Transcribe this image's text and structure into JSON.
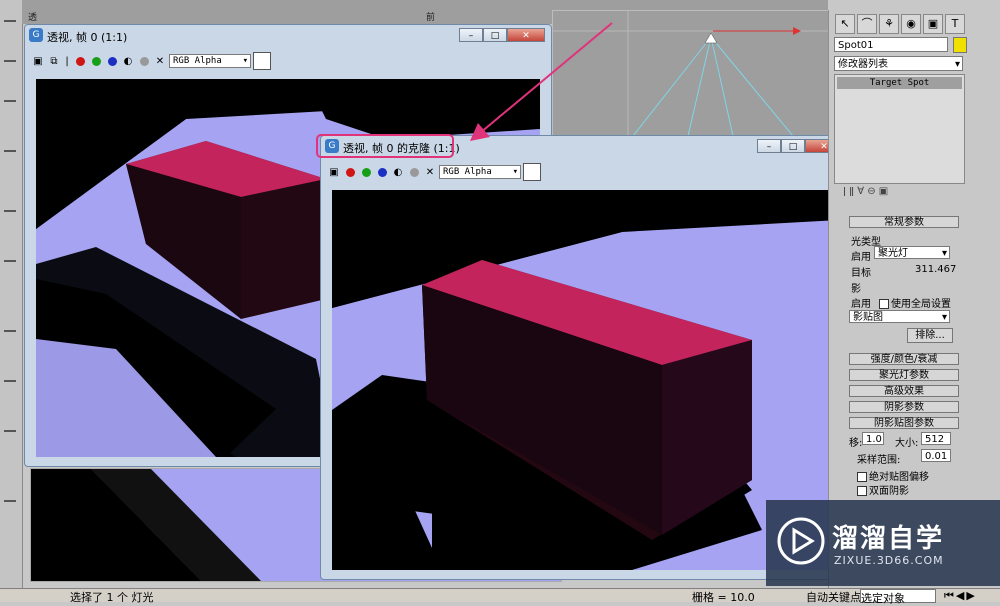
{
  "window_main": {
    "title": "透视, 帧 0 (1:1)",
    "channel": "RGB Alpha"
  },
  "window_clone": {
    "title": "透视, 帧 0 的克隆 (1:1)",
    "channel": "RGB Alpha"
  },
  "colors": {
    "accent_highlight": "#e0337a",
    "object_top": "#c3245c",
    "ground": "#a6a4f2",
    "red_channel": "#d01515",
    "green_channel": "#17a017",
    "blue_channel": "#1b2fc2"
  },
  "command_panel": {
    "object_name": "Spot01",
    "modifier_list": "修改器列表",
    "stack_item": "Target Spot",
    "rollout_general": "常规参数",
    "light_type_label": "光类型",
    "enable_label": "启用",
    "light_type_value": "聚光灯",
    "target_label": "目标",
    "target_value": "311.467",
    "shadow_label": "影",
    "shadow_enable": "启用",
    "use_global": "使用全局设置",
    "shadow_type": "影贴图",
    "exclude_button": "排除...",
    "rollout_intensity": "强度/颜色/衰减",
    "rollout_spot": "聚光灯参数",
    "rollout_advanced": "高级效果",
    "rollout_shadow": "阴影参数",
    "rollout_shadowmap": "阴影贴图参数",
    "bias_label": "移:",
    "bias_value": "1.0",
    "size_label": "大小:",
    "size_value": "512",
    "sample_label": "采样范围:",
    "sample_value": "0.01",
    "abs_bias": "绝对贴图偏移",
    "two_sided": "双面阴影"
  },
  "status": {
    "selection": "选择了 1 个 灯光",
    "grid": "栅格 = 10.0",
    "auto_key": "自动关键点",
    "key_filter": "选定对象"
  },
  "watermark": {
    "brand": "溜溜自学",
    "url": "ZIXUE.3D66.COM"
  },
  "viewport_labels": {
    "top_left": "透",
    "top_right": "前"
  }
}
